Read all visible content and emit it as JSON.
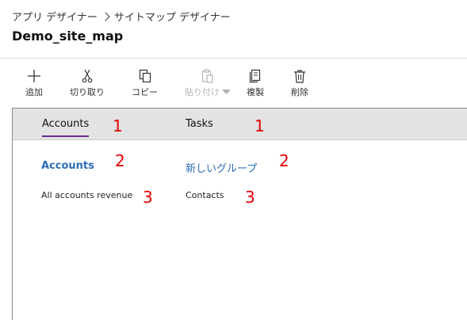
{
  "breadcrumb": {
    "app_designer": "アプリ デザイナー",
    "sitemap_designer": "サイトマップ デザイナー"
  },
  "page_title": "Demo_site_map",
  "toolbar": {
    "add": "追加",
    "cut": "切り取り",
    "copy": "コピー",
    "paste": "貼り付け",
    "duplicate": "複製",
    "delete": "削除"
  },
  "areas": [
    {
      "label": "Accounts",
      "marker": "1"
    },
    {
      "label": "Tasks",
      "marker": "1"
    }
  ],
  "groups": [
    {
      "label": "Accounts",
      "marker": "2"
    },
    {
      "label": "新しいグループ",
      "marker": "2"
    }
  ],
  "subareas": [
    {
      "label": "All accounts revenue",
      "marker": "3"
    },
    {
      "label": "Contacts",
      "marker": "3"
    }
  ],
  "colors": {
    "accent": "#6b2c91",
    "link": "#2b6cb8",
    "marker": "#e00000",
    "area_bar": "#e3e3e3"
  },
  "icons": [
    "plus-icon",
    "scissors-icon",
    "copy-icon",
    "paste-icon",
    "duplicate-icon",
    "trash-icon",
    "chevron-right-icon",
    "dropdown-arrow-icon"
  ]
}
